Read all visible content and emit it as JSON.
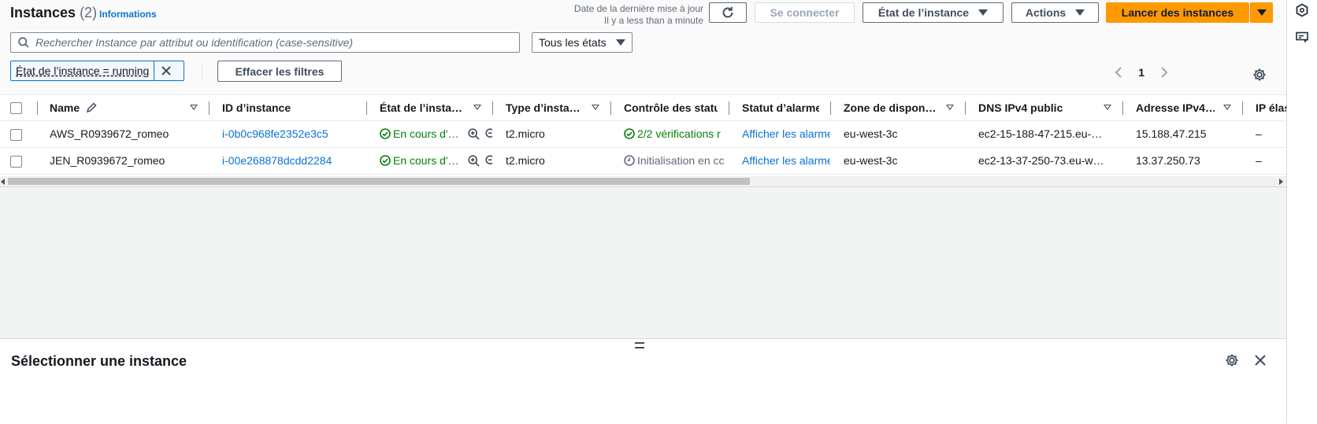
{
  "header": {
    "title": "Instances",
    "count": "(2)",
    "info_link": "Informations",
    "last_update_label": "Date de la dernière mise à jour",
    "last_update_value": "Il y a less than a minute"
  },
  "toolbar": {
    "connect": "Se connecter",
    "instance_state": "État de l’instance",
    "actions": "Actions",
    "launch": "Lancer des instances"
  },
  "search": {
    "placeholder": "Rechercher Instance par attribut ou identification (case-sensitive)"
  },
  "state_filter": {
    "selected": "Tous les états"
  },
  "active_filter": {
    "label": "État de l’instance = running"
  },
  "clear_filters": "Effacer les filtres",
  "pagination": {
    "page": "1"
  },
  "columns": [
    "Name",
    "ID d’instance",
    "État de l’insta…",
    "Type d’insta…",
    "Contrôle des statu",
    "Statut d’alarme",
    "Zone de dispon…",
    "DNS IPv4 public",
    "Adresse IPv4…",
    "IP élas"
  ],
  "rows": [
    {
      "name": "AWS_R0939672_romeo",
      "id": "i-0b0c968fe2352e3c5",
      "state": "En cours d'…",
      "type": "t2.micro",
      "status_check": "2/2 vérifications r",
      "alarm": "Afficher les alarme",
      "zone": "eu-west-3c",
      "dns": "ec2-15-188-47-215.eu-…",
      "ipv4": "15.188.47.215",
      "elastic": "–"
    },
    {
      "name": "JEN_R0939672_romeo",
      "id": "i-00e268878dcdd2284",
      "state": "En cours d'…",
      "type": "t2.micro",
      "status_check": "Initialisation en cc",
      "alarm": "Afficher les alarme",
      "zone": "eu-west-3c",
      "dns": "ec2-13-37-250-73.eu-w…",
      "ipv4": "13.37.250.73",
      "elastic": "–"
    }
  ],
  "details_panel": {
    "title": "Sélectionner une instance"
  },
  "colors": {
    "primary": "#ff9900",
    "link": "#0972d3",
    "success": "#037f0c"
  }
}
